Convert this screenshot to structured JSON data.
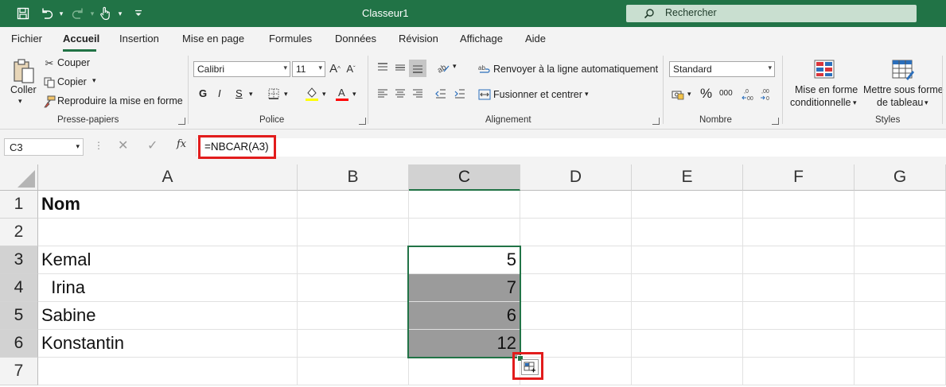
{
  "app": {
    "document_title": "Classeur1",
    "search_placeholder": "Rechercher"
  },
  "tabs": [
    "Fichier",
    "Accueil",
    "Insertion",
    "Mise en page",
    "Formules",
    "Données",
    "Révision",
    "Affichage",
    "Aide"
  ],
  "active_tab": "Accueil",
  "ribbon": {
    "clipboard": {
      "paste_label": "Coller",
      "cut_label": "Couper",
      "copy_label": "Copier",
      "format_painter_label": "Reproduire la mise en forme",
      "group_label": "Presse-papiers"
    },
    "font": {
      "font_name": "Calibri",
      "font_size": "11",
      "bold": "G",
      "italic": "I",
      "underline": "S",
      "group_label": "Police",
      "fill_color": "#ffff00",
      "font_color": "#ff0000"
    },
    "alignment": {
      "wrap_text_label": "Renvoyer à la ligne automatiquement",
      "merge_label": "Fusionner et centrer",
      "group_label": "Alignement"
    },
    "number": {
      "format": "Standard",
      "percent": "%",
      "thousands": "000",
      "group_label": "Nombre"
    },
    "styles": {
      "conditional_line1": "Mise en forme",
      "conditional_line2": "conditionnelle",
      "table_line1": "Mettre sous forme",
      "table_line2": "de tableau",
      "group_label": "Styles"
    }
  },
  "formula_bar": {
    "name_box": "C3",
    "fx_label": "fx",
    "formula": "=NBCAR(A3)"
  },
  "sheet": {
    "columns": [
      "A",
      "B",
      "C",
      "D",
      "E",
      "F",
      "G"
    ],
    "rows": [
      "1",
      "2",
      "3",
      "4",
      "5",
      "6",
      "7"
    ],
    "cells": {
      "A1": "Nom",
      "A3": "Kemal",
      "A4": "  Irina",
      "A5": "Sabine",
      "A6": "Konstantin",
      "C3": "5",
      "C4": "7",
      "C5": "6",
      "C6": "12"
    },
    "selected_range": "C3:C6",
    "active_cell": "C3"
  },
  "colors": {
    "accent": "#217346",
    "highlight_box": "#e21c1c",
    "selection_fill": "#9b9b9b"
  }
}
